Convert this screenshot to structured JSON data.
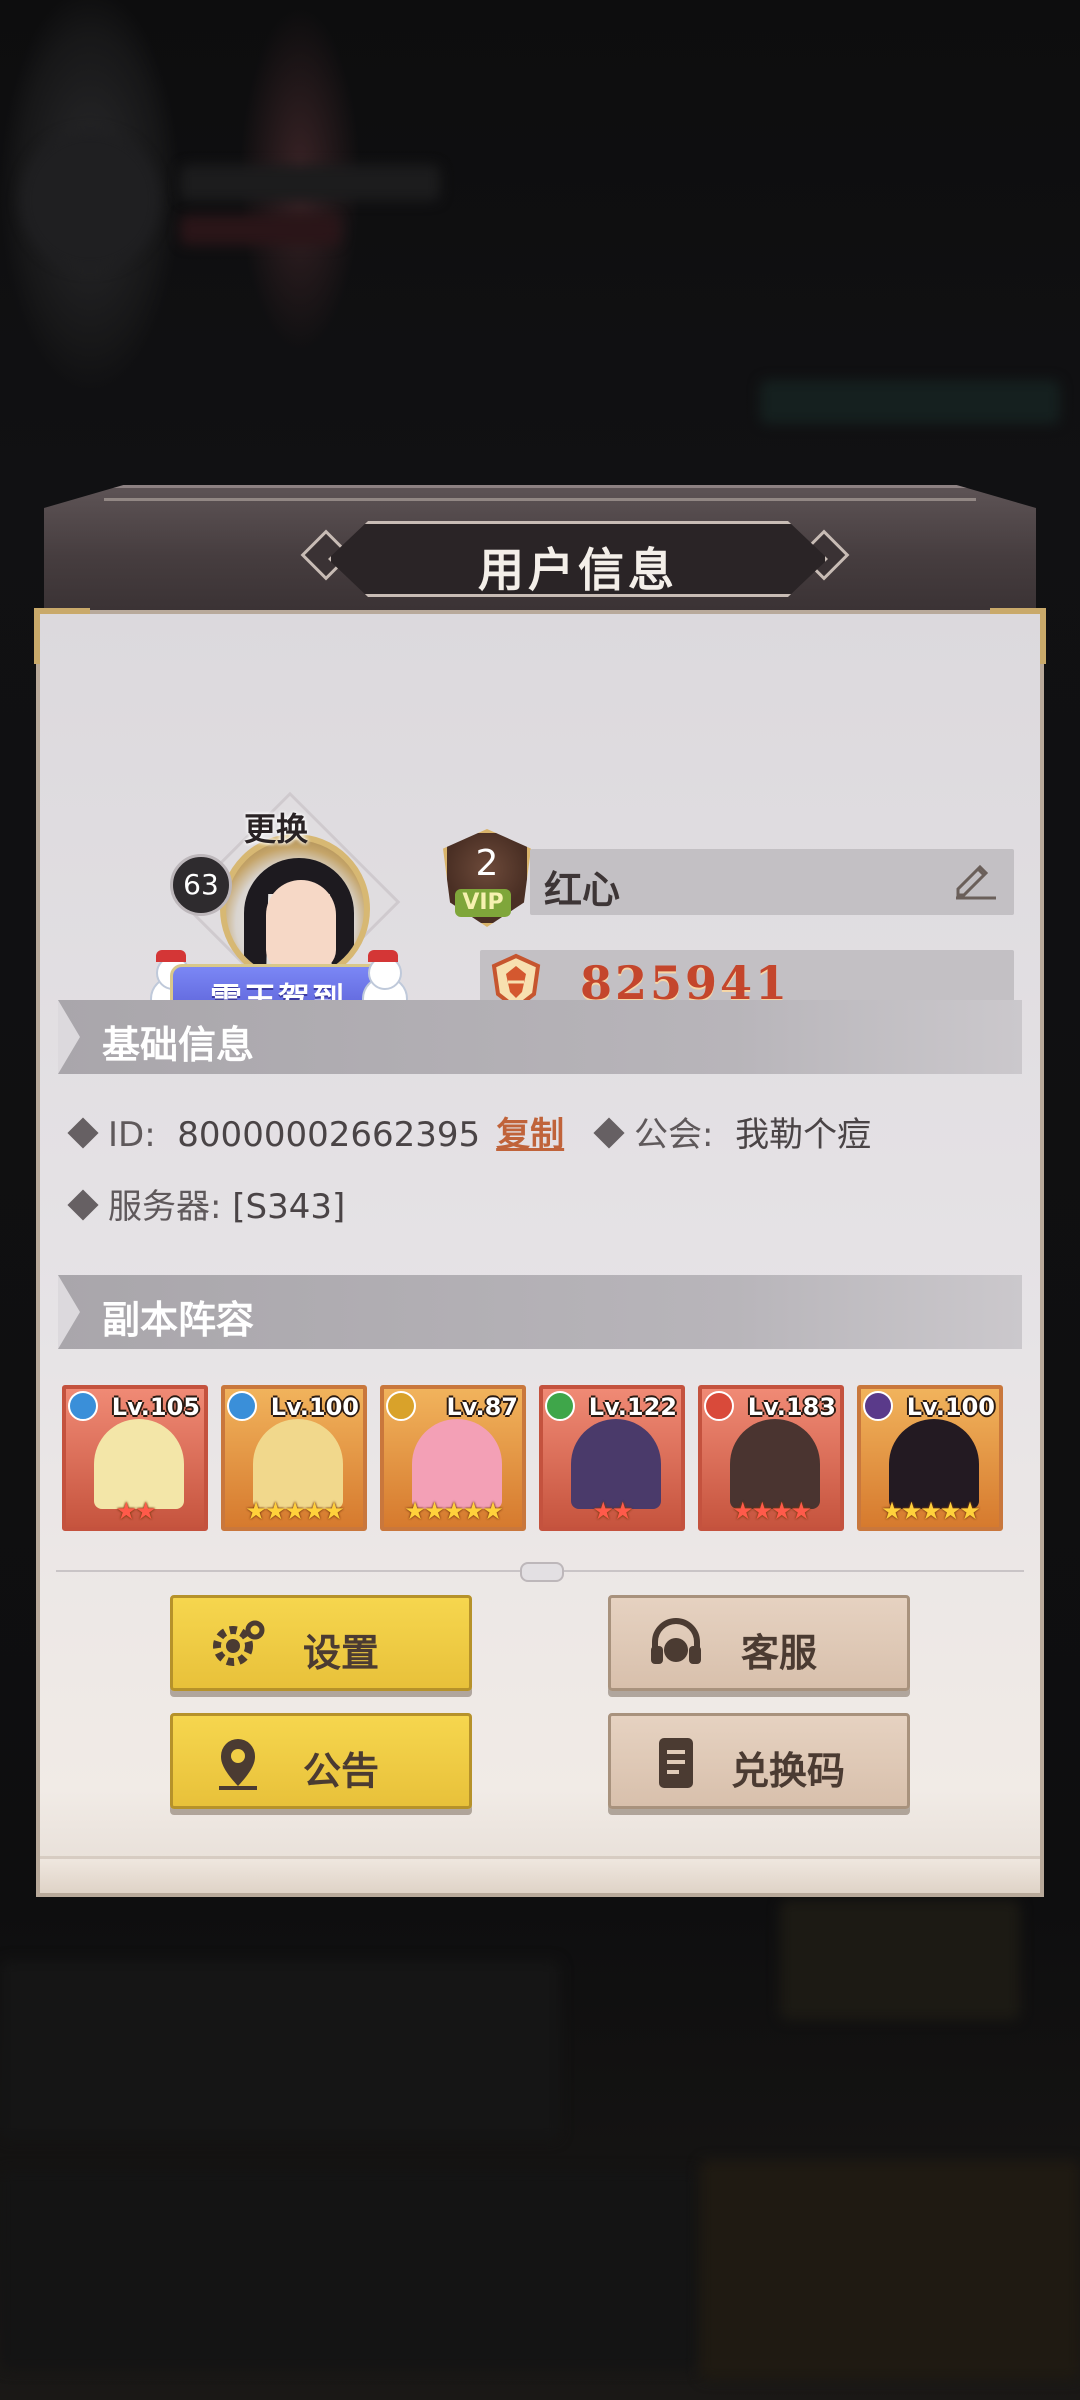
{
  "modal": {
    "title": "用户信息"
  },
  "profile": {
    "change_label": "更换",
    "level": "63",
    "frame_banner": "雪王驾到",
    "vip_level": "2",
    "vip_label": "VIP",
    "name": "红心",
    "currency_value": "825941"
  },
  "basic_info": {
    "title": "基础信息",
    "id_label": "ID:",
    "id_value": "80000002662395",
    "copy_label": "复制",
    "guild_label": "公会:",
    "guild_value": "我勒个痘",
    "server_label": "服务器:",
    "server_value": "[S343]"
  },
  "lineup": {
    "title": "副本阵容",
    "heroes": [
      {
        "level": "Lv.105",
        "stars": "★★",
        "frame": "red",
        "element_color": "#3a8fd9",
        "art_color": "#f3e6a8"
      },
      {
        "level": "Lv.100",
        "stars": "★★★★★",
        "frame": "orange",
        "element_color": "#3a8fd9",
        "art_color": "#f1d88c"
      },
      {
        "level": "Lv.87",
        "stars": "★★★★★",
        "frame": "orange",
        "element_color": "#d9a22a",
        "art_color": "#f3a0b6"
      },
      {
        "level": "Lv.122",
        "stars": "★★",
        "frame": "red",
        "element_color": "#3fa64a",
        "art_color": "#4a3a6a"
      },
      {
        "level": "Lv.183",
        "stars": "★★★★",
        "frame": "red",
        "element_color": "#d94a3a",
        "art_color": "#4a3430"
      },
      {
        "level": "Lv.100",
        "stars": "★★★★★",
        "frame": "orange",
        "element_color": "#5a3a8a",
        "art_color": "#231a22"
      }
    ]
  },
  "buttons": {
    "settings": "设置",
    "customer_service": "客服",
    "announcement": "公告",
    "redeem_code": "兑换码"
  }
}
